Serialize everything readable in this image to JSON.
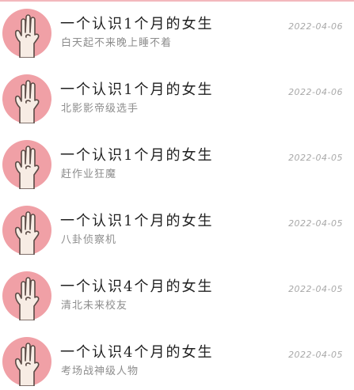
{
  "feed": {
    "items": [
      {
        "title": "一个认识1个月的女生",
        "subtitle": "白天起不来晚上睡不着",
        "date": "2022-04-06",
        "avatar_icon": "hand-gesture-avatar-icon"
      },
      {
        "title": "一个认识1个月的女生",
        "subtitle": "北影影帝级选手",
        "date": "2022-04-06",
        "avatar_icon": "hand-gesture-avatar-icon"
      },
      {
        "title": "一个认识1个月的女生",
        "subtitle": "赶作业狂魔",
        "date": "2022-04-05",
        "avatar_icon": "hand-gesture-avatar-icon"
      },
      {
        "title": "一个认识1个月的女生",
        "subtitle": "八卦侦察机",
        "date": "2022-04-05",
        "avatar_icon": "hand-gesture-avatar-icon"
      },
      {
        "title": "一个认识4个月的女生",
        "subtitle": "清北未来校友",
        "date": "2022-04-05",
        "avatar_icon": "hand-gesture-avatar-icon"
      },
      {
        "title": "一个认识4个月的女生",
        "subtitle": "考场战神级人物",
        "date": "2022-04-05",
        "avatar_icon": "hand-gesture-avatar-icon"
      }
    ]
  },
  "colors": {
    "avatar_bg": "#f0a0a6",
    "hand": "#f7ece4",
    "hand_outline": "#5a4a45",
    "title": "#1f1f1f",
    "subtitle": "#8d8d8d",
    "date": "#a8a8a8"
  }
}
